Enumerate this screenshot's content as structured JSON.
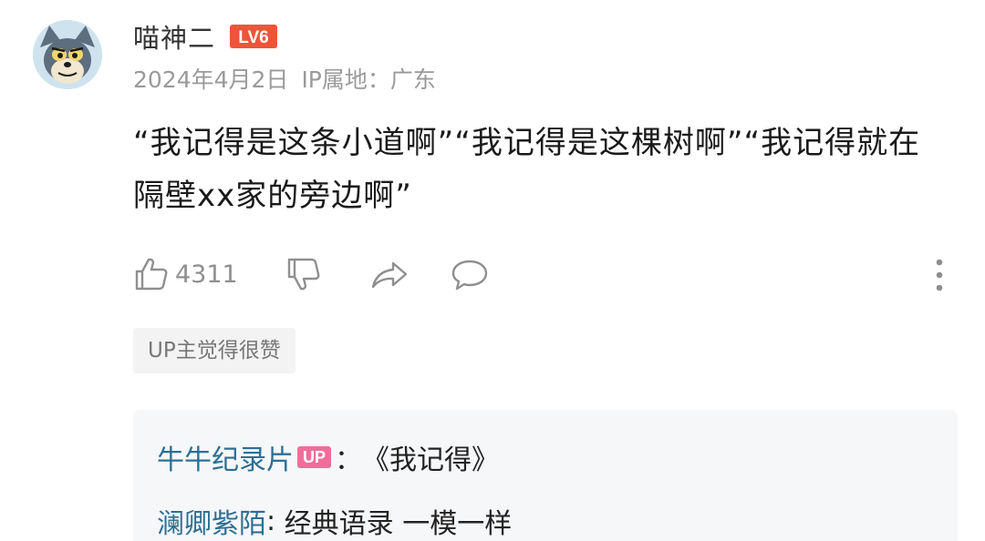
{
  "comment": {
    "user": {
      "name": "喵神二",
      "level": "LV6",
      "avatar": "tom-cat-avatar"
    },
    "date": "2024年4月2日",
    "ip_location": "IP属地：广东",
    "text": "“我记得是这条小道啊”“我记得是这棵树啊”“我记得就在隔壁xx家的旁边啊”",
    "likes": "4311",
    "up_liked_label": "UP主觉得很赞"
  },
  "replies": [
    {
      "author": "牛牛纪录片",
      "badge": "UP",
      "separator": "：",
      "text": "《我记得》"
    },
    {
      "author": "澜卿紫陌",
      "separator": ": ",
      "text": "经典语录 一模一样"
    }
  ],
  "colors": {
    "level_badge": "#f0533a",
    "up_badge": "#f06d9a",
    "link": "#2e6f93",
    "meta": "#9a9a9a"
  },
  "icons": [
    "thumbs-up-icon",
    "thumbs-down-icon",
    "share-icon",
    "reply-icon",
    "more-vertical-icon"
  ]
}
